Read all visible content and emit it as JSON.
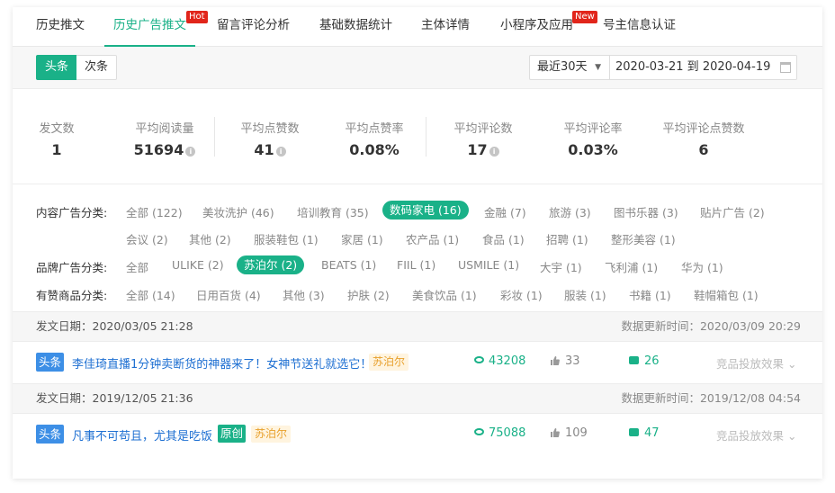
{
  "tabs": [
    {
      "label": "历史推文"
    },
    {
      "label": "历史广告推文",
      "badge": "Hot"
    },
    {
      "label": "留言评论分析"
    },
    {
      "label": "基础数据统计"
    },
    {
      "label": "主体详情"
    },
    {
      "label": "小程序及应用",
      "badge": "New"
    },
    {
      "label": "号主信息认证"
    }
  ],
  "toolbar": {
    "position_on": "头条",
    "position_off": "次条",
    "period": "最近30天",
    "date_range": "2020-03-21 到 2020-04-19"
  },
  "stats": [
    {
      "label": "发文数",
      "value": "1"
    },
    {
      "label": "平均阅读量",
      "value": "51694"
    },
    {
      "label": "平均点赞数",
      "value": "41"
    },
    {
      "label": "平均点赞率",
      "value": "0.08%"
    },
    {
      "label": "平均评论数",
      "value": "17"
    },
    {
      "label": "平均评论率",
      "value": "0.03%"
    },
    {
      "label": "平均评论点赞数",
      "value": "6"
    }
  ],
  "filters": {
    "content": {
      "label": "内容广告分类:",
      "row1": [
        "全部 (122)",
        "美妆洗护 (46)",
        "培训教育 (35)",
        "数码家电 (16)",
        "金融 (7)",
        "旅游 (3)",
        "图书乐器 (3)",
        "贴片广告 (2)"
      ],
      "row2": [
        "会议 (2)",
        "其他 (2)",
        "服装鞋包 (1)",
        "家居 (1)",
        "农产品 (1)",
        "食品 (1)",
        "招聘 (1)",
        "整形美容 (1)"
      ]
    },
    "brand": {
      "label": "品牌广告分类:",
      "items": [
        "全部",
        "ULIKE (2)",
        "苏泊尔 (2)",
        "BEATS (1)",
        "FIIL (1)",
        "USMILE (1)",
        "大宇 (1)",
        "飞利浦 (1)",
        "华为 (1)"
      ]
    },
    "goods": {
      "label": "有赞商品分类:",
      "items": [
        "全部 (14)",
        "日用百货 (4)",
        "其他 (3)",
        "护肤 (2)",
        "美食饮品 (1)",
        "彩妆 (1)",
        "服装 (1)",
        "书籍 (1)",
        "鞋帽箱包 (1)"
      ]
    }
  },
  "articles": [
    {
      "date": "发文日期：2020/03/05 21:28",
      "updated": "数据更新时间：2020/03/09 20:29",
      "position_tag": "头条",
      "title": "李佳琦直播1分钟卖断货的神器来了！女神节送礼就选它！",
      "brand": "苏泊尔",
      "reads": "43208",
      "likes": "33",
      "comments": "26",
      "effect_label": "竞品投放效果"
    },
    {
      "date": "发文日期：2019/12/05 21:36",
      "updated": "数据更新时间：2019/12/08 04:54",
      "position_tag": "头条",
      "title": "凡事不可苟且，尤其是吃饭",
      "original_tag": "原创",
      "brand": "苏泊尔",
      "reads": "75088",
      "likes": "109",
      "comments": "47",
      "effect_label": "竞品投放效果"
    }
  ],
  "colors": {
    "accent": "#1ab188",
    "link": "#1d6fd2",
    "head_tag": "#3d8fe6",
    "hot_badge": "#e1251b"
  }
}
